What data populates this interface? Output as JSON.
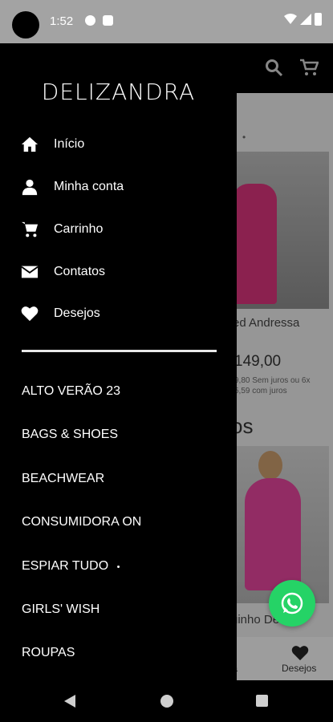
{
  "status_bar": {
    "time": "1:52"
  },
  "drawer": {
    "brand": "DELIZANDRA",
    "menu": [
      {
        "label": "Início",
        "icon": "home-icon"
      },
      {
        "label": "Minha conta",
        "icon": "person-icon"
      },
      {
        "label": "Carrinho",
        "icon": "cart-icon"
      },
      {
        "label": "Contatos",
        "icon": "mail-icon"
      },
      {
        "label": "Desejos",
        "icon": "heart-icon"
      }
    ],
    "categories": [
      "ALTO VERÃO 23",
      "BAGS & SHOES",
      "BEACHWEAR",
      "CONSUMIDORA ON",
      "ESPIAR TUDO",
      "GIRLS' WISH",
      "ROUPAS"
    ],
    "espiar_marker": "•"
  },
  "background": {
    "product1_name": "ed Andressa",
    "product1_price": "149,00",
    "product1_installments_line1": "9,80 Sem juros ou 6x",
    "product1_installments_line2": "5,59 com juros",
    "section_title": "os",
    "product2_name": "uinho De",
    "bottom_nav_left": "ta",
    "bottom_nav_wishlist": "Desejos",
    "dot": "•"
  }
}
